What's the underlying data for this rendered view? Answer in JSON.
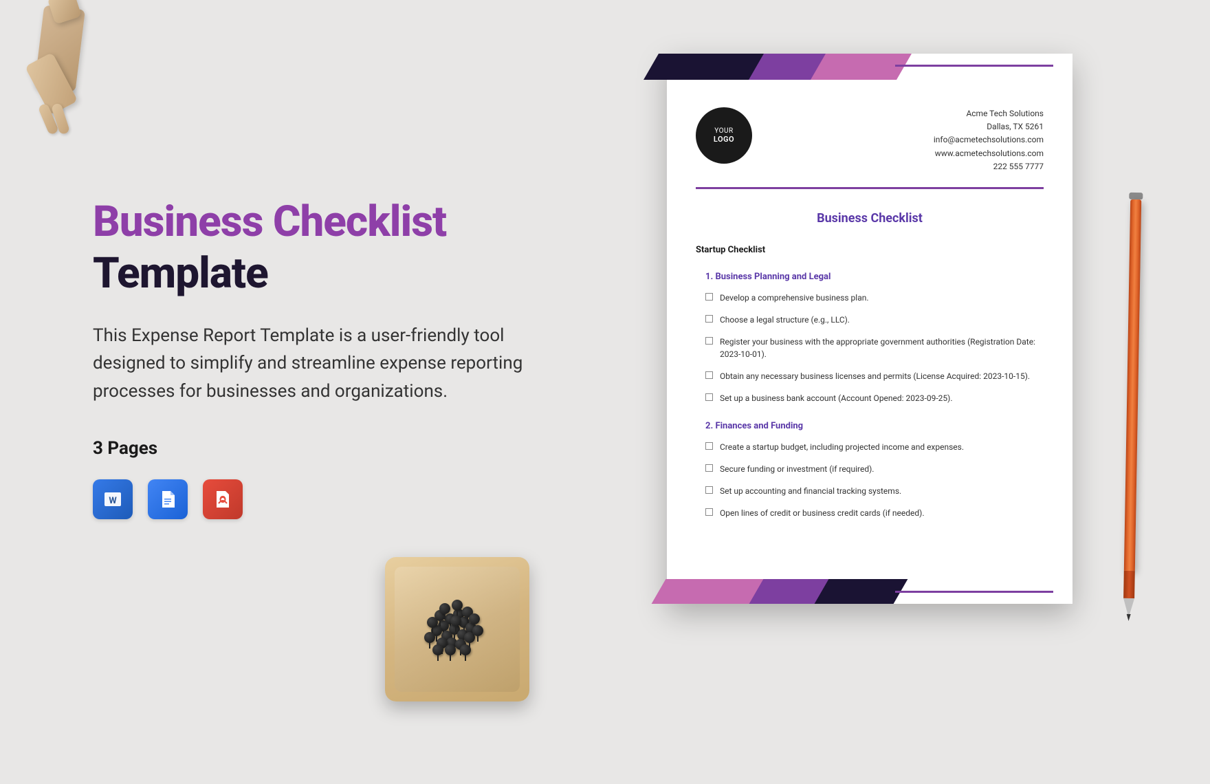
{
  "title_line1": "Business Checklist",
  "title_line2": "Template",
  "description": "This Expense Report Template is a user-friendly tool designed to simplify and streamline expense reporting processes for businesses and organizations.",
  "pages_label": "3 Pages",
  "formats": [
    "word",
    "gdoc",
    "pdf"
  ],
  "document": {
    "logo_top": "YOUR",
    "logo_bottom": "LOGO",
    "company": {
      "name": "Acme Tech Solutions",
      "address": "Dallas, TX 5261",
      "email": "info@acmetechsolutions.com",
      "website": "www.acmetechsolutions.com",
      "phone": "222 555 7777"
    },
    "title": "Business Checklist",
    "sub_heading": "Startup Checklist",
    "sections": [
      {
        "number": "1.",
        "name": "Business Planning and Legal",
        "items": [
          "Develop a comprehensive business plan.",
          "Choose a legal structure (e.g., LLC).",
          "Register your business with the appropriate government authorities (Registration Date: 2023-10-01).",
          "Obtain any necessary business licenses and permits (License Acquired: 2023-10-15).",
          "Set up a business bank account (Account Opened: 2023-09-25)."
        ]
      },
      {
        "number": "2.",
        "name": "Finances and Funding",
        "items": [
          "Create a startup budget, including projected income and expenses.",
          "Secure funding or investment (if required).",
          "Set up accounting and financial tracking systems.",
          "Open lines of credit or business credit cards (if needed)."
        ]
      }
    ]
  }
}
